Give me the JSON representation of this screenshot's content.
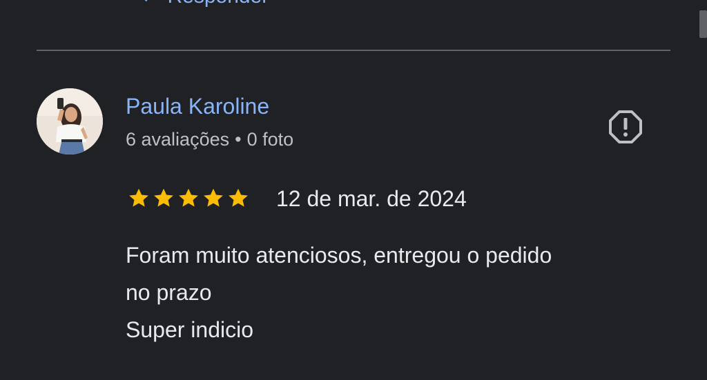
{
  "previous_review": {
    "reply_icon": "reply-arrow-icon",
    "reply_label": "Responder"
  },
  "review": {
    "reviewer": {
      "name": "Paula Karoline",
      "avatar_icon": "profile-photo",
      "reviews_count": "6 avaliações",
      "separator": "•",
      "photos_count": "0 foto"
    },
    "report_icon": "report-flag-icon",
    "rating": {
      "stars": 5,
      "max": 5,
      "color": "#fbbc04"
    },
    "date": "12 de mar. de 2024",
    "text_lines": [
      "Foram muito atenciosos, entregou o pedido",
      "no prazo",
      "Super indicio"
    ]
  },
  "colors": {
    "background": "#202124",
    "link": "#8ab4f8",
    "text_primary": "#e8eaed",
    "text_secondary": "#bdc1c6",
    "divider": "#5f6368"
  }
}
